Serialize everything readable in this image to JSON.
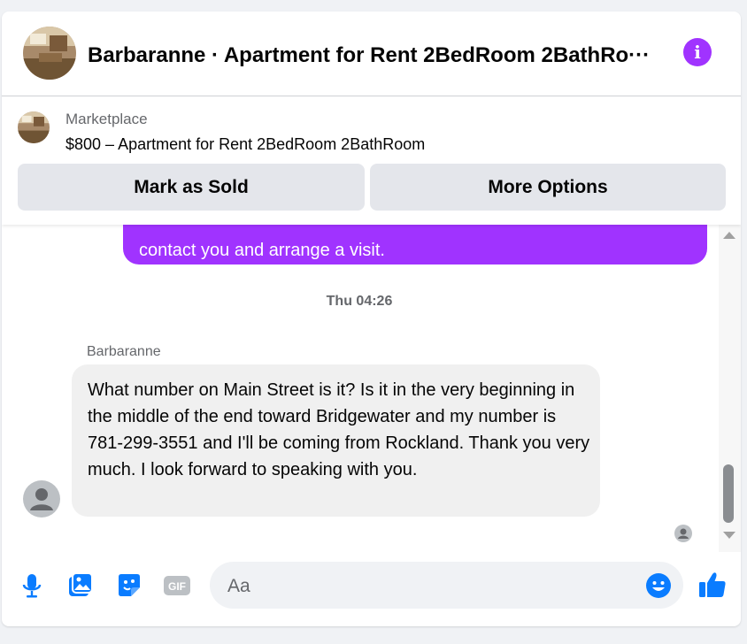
{
  "header": {
    "title": "Barbaranne · Apartment for Rent 2BedRoom 2BathRo···",
    "info_icon": "info-icon"
  },
  "listing": {
    "label": "Marketplace",
    "title": "$800 – Apartment for Rent 2BedRoom 2BathRoom",
    "mark_sold_label": "Mark as Sold",
    "more_options_label": "More Options"
  },
  "messages": {
    "outgoing_partial": "contact you and arrange a visit.",
    "timestamp": "Thu 04:26",
    "sender": "Barbaranne",
    "incoming_text": "What number on Main Street is it? Is it in the very beginning in the middle of the end toward Bridgewater and my number is 781-299-3551 and I'll be coming from Rockland. Thank you very much. I look forward to speaking with you."
  },
  "composer": {
    "placeholder": "Aa",
    "icons": [
      "microphone-icon",
      "image-icon",
      "sticker-icon",
      "gif-icon",
      "emoji-icon",
      "thumbs-up-icon"
    ],
    "gif_label": "GIF"
  },
  "colors": {
    "accent": "#a033ff",
    "blue": "#0a7cff",
    "bubble_in": "#f0f0f0",
    "button": "#e4e6eb"
  }
}
